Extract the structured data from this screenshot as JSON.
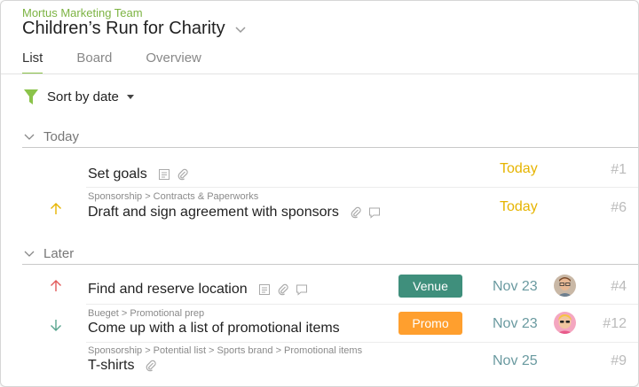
{
  "header": {
    "team_name": "Mortus Marketing Team",
    "project_title": "Children’s Run for Charity"
  },
  "tabs": [
    {
      "label": "List",
      "active": true
    },
    {
      "label": "Board",
      "active": false
    },
    {
      "label": "Overview",
      "active": false
    }
  ],
  "sort": {
    "label": "Sort by date"
  },
  "sections": {
    "today": {
      "label": "Today"
    },
    "later": {
      "label": "Later"
    }
  },
  "tasks": [
    {
      "title": "Set goals",
      "breadcrumb": "",
      "priority": "",
      "tag": "",
      "date": "Today",
      "number": "#1",
      "icons": [
        "note-icon",
        "paperclip-icon"
      ]
    },
    {
      "title": "Draft and sign agreement with sponsors",
      "breadcrumb": "Sponsorship > Contracts & Paperworks",
      "priority": "up-yellow",
      "tag": "",
      "date": "Today",
      "number": "#6",
      "icons": [
        "paperclip-icon",
        "comment-icon"
      ]
    },
    {
      "title": "Find and reserve location",
      "breadcrumb": "",
      "priority": "up-red",
      "tag": "Venue",
      "date": "Nov 23",
      "number": "#4",
      "icons": [
        "note-icon",
        "paperclip-icon",
        "comment-icon"
      ],
      "avatar": "avatar-man"
    },
    {
      "title": "Come up with a list of promotional items",
      "breadcrumb": "Bueget > Promotional prep",
      "priority": "down-teal",
      "tag": "Promo",
      "date": "Nov 23",
      "number": "#12",
      "icons": [],
      "avatar": "avatar-woman"
    },
    {
      "title": "T-shirts",
      "breadcrumb": "Sponsorship > Potential list > Sports brand > Promotional items",
      "priority": "",
      "tag": "",
      "date": "Nov 25",
      "number": "#9",
      "icons": [
        "paperclip-icon"
      ]
    }
  ],
  "colors": {
    "accent_green": "#8bc34a",
    "today_yellow": "#e6b400",
    "later_teal": "#6a9aa0",
    "venue_tag": "#3f8f7c",
    "promo_tag": "#ff9f2e",
    "priority_up_red": "#e25a5a",
    "priority_up_yellow": "#e6b400",
    "priority_down_teal": "#5aa58f"
  }
}
